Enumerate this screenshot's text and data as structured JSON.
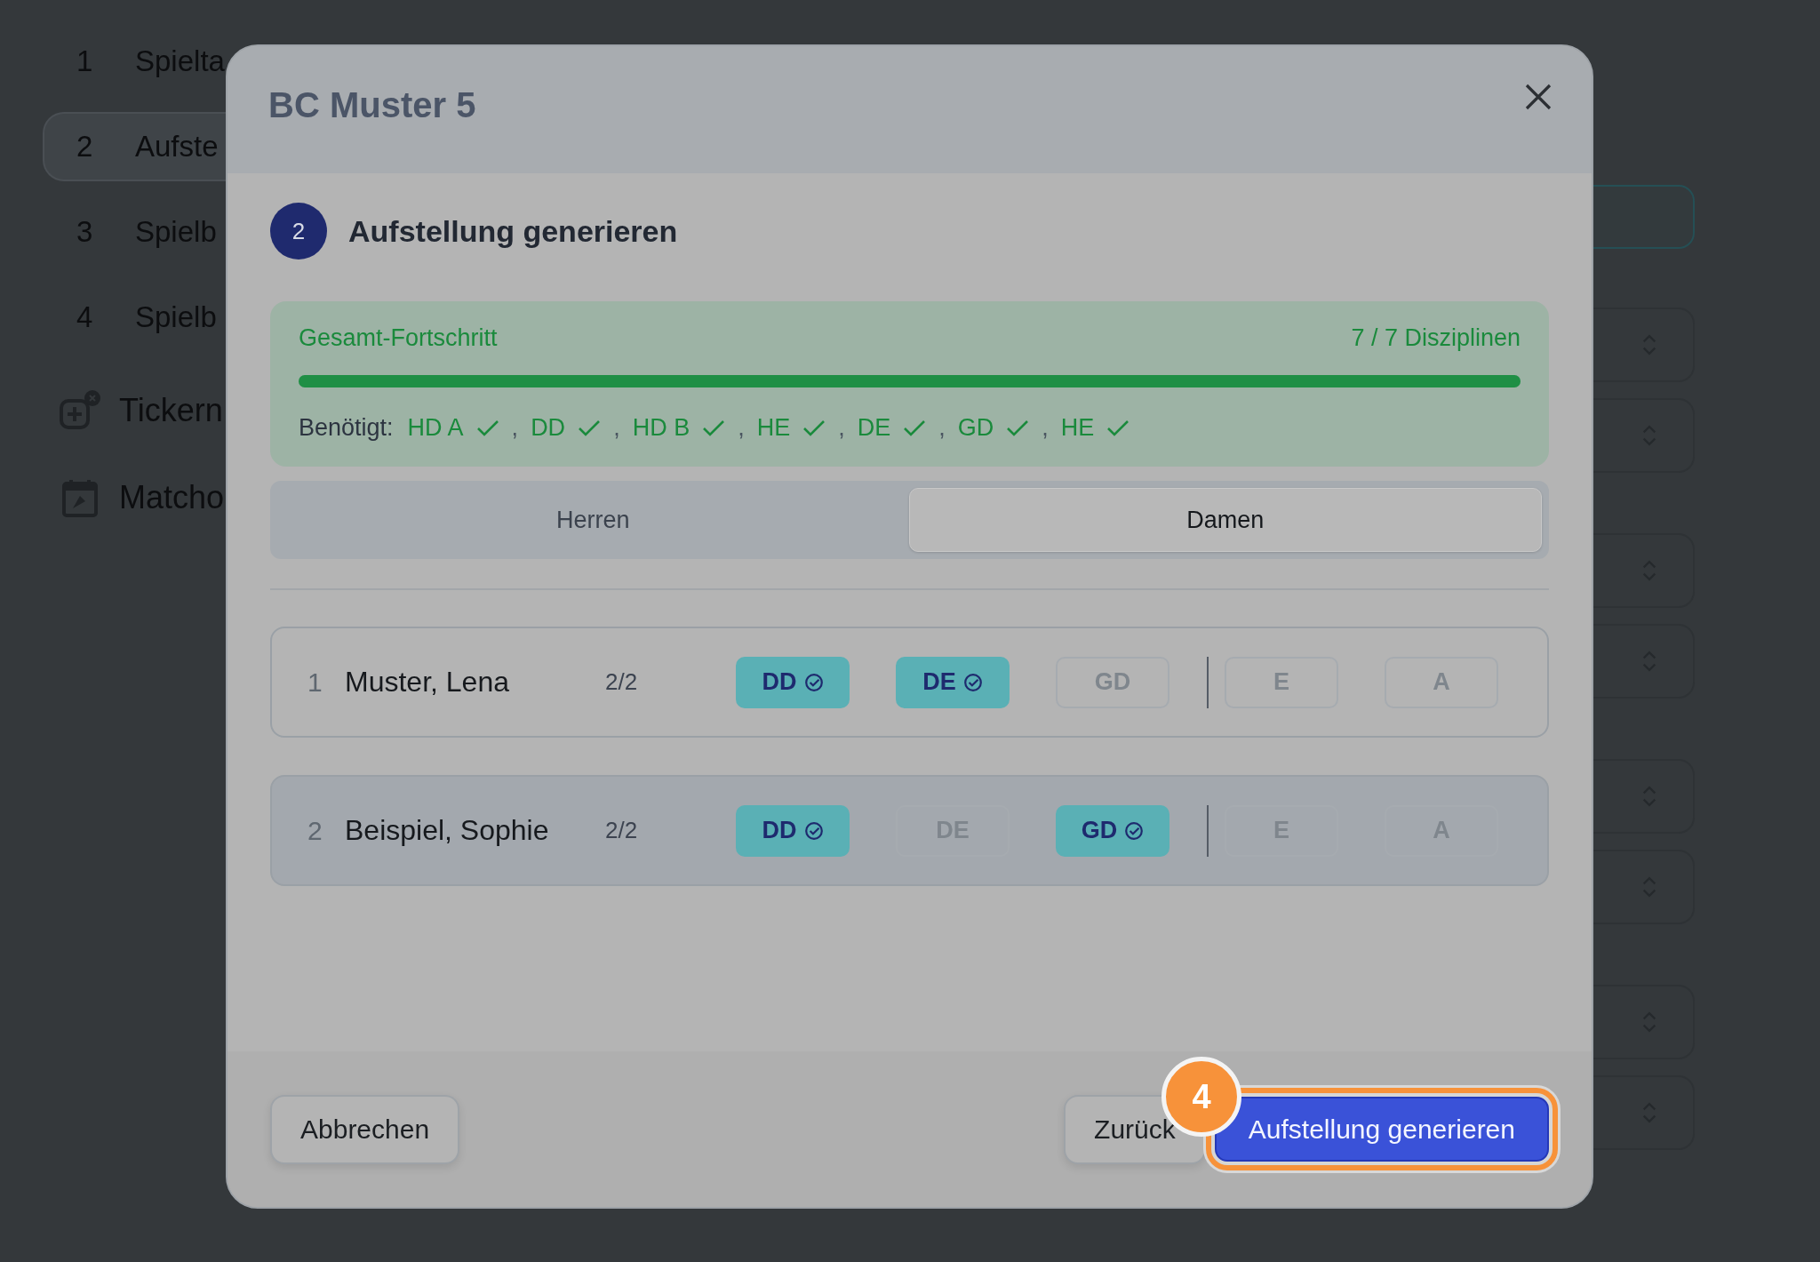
{
  "sidebar": {
    "steps": [
      {
        "number": "1",
        "label": "Spielta",
        "selected": false
      },
      {
        "number": "2",
        "label": "Aufste",
        "selected": true
      },
      {
        "number": "3",
        "label": "Spielb",
        "selected": false
      },
      {
        "number": "4",
        "label": "Spielb",
        "selected": false
      }
    ],
    "links": [
      {
        "kind": "ticker",
        "label": "Tickern"
      },
      {
        "kind": "calendar",
        "label": "Matcho"
      }
    ]
  },
  "background_fields": [
    {
      "kind": "active"
    },
    {
      "kind": "select"
    },
    {
      "kind": "select"
    },
    {
      "kind": "select"
    },
    {
      "kind": "select"
    },
    {
      "kind": "select"
    },
    {
      "kind": "select"
    },
    {
      "kind": "select"
    },
    {
      "kind": "select"
    }
  ],
  "modal": {
    "title": "BC Muster 5",
    "step": {
      "number": "2",
      "title": "Aufstellung generieren"
    },
    "progress": {
      "label": "Gesamt-Fortschritt",
      "count": "7 / 7 Disziplinen",
      "level": 1,
      "required_label": "Benötigt:",
      "separator": ",",
      "required": [
        {
          "label": "HD A",
          "done": true
        },
        {
          "label": "DD",
          "done": true
        },
        {
          "label": "HD B",
          "done": true
        },
        {
          "label": "HE",
          "done": true
        },
        {
          "label": "DE",
          "done": true
        },
        {
          "label": "GD",
          "done": true
        },
        {
          "label": "HE",
          "done": true
        }
      ]
    },
    "tabs": [
      {
        "label": "Herren",
        "selected": false
      },
      {
        "label": "Damen",
        "selected": true
      }
    ],
    "players": [
      {
        "number": "1",
        "name": "Muster, Lena",
        "count": "2/2",
        "highlighted": false,
        "disciplines": [
          {
            "label": "DD",
            "selected": true
          },
          {
            "label": "DE",
            "selected": true
          },
          {
            "label": "GD",
            "selected": false
          }
        ],
        "extras": [
          {
            "label": "E",
            "selected": false
          },
          {
            "label": "A",
            "selected": false
          }
        ]
      },
      {
        "number": "2",
        "name": "Beispiel, Sophie",
        "count": "2/2",
        "highlighted": true,
        "disciplines": [
          {
            "label": "DD",
            "selected": true
          },
          {
            "label": "DE",
            "selected": false
          },
          {
            "label": "GD",
            "selected": true
          }
        ],
        "extras": [
          {
            "label": "E",
            "selected": false
          },
          {
            "label": "A",
            "selected": false
          }
        ]
      }
    ],
    "footer": {
      "cancel": "Abbrechen",
      "back": "Zurück",
      "primary": "Aufstellung generieren",
      "primary_highlighted": true,
      "step_badge": "4"
    }
  }
}
